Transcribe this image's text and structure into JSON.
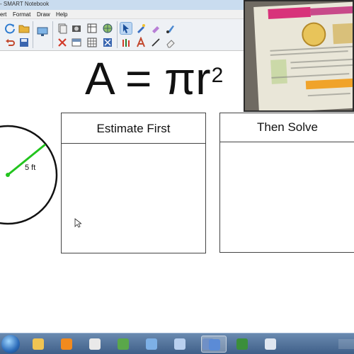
{
  "window": {
    "title": "- SMART Notebook"
  },
  "menu": {
    "items": [
      "ert",
      "Format",
      "Draw",
      "Help"
    ]
  },
  "toolbar": {
    "buttons": [
      "refresh-icon",
      "folder-icon",
      "display-icon",
      "copy-icon",
      "camera-icon",
      "table-icon",
      "globe-icon",
      "select-arrow-icon",
      "magic-pen-icon",
      "eraser-pen-icon",
      "paint-brush-icon",
      "undo-icon",
      "save-icon",
      "delete-icon",
      "screen-shade-icon",
      "table-grid-icon",
      "fullscreen-icon",
      "pens-icon",
      "text-icon",
      "line-icon",
      "eraser-icon"
    ],
    "selected": "select-arrow-icon"
  },
  "canvas": {
    "formula": {
      "left": "A = π",
      "right": "r",
      "exponent": "2"
    },
    "circle": {
      "radius_label": "5 ft",
      "stroke": "#111111",
      "radius_color": "#22c41e"
    },
    "boxes": [
      {
        "title": "Estimate First"
      },
      {
        "title": "Then Solve"
      }
    ]
  },
  "webcam": {
    "description_hidden": true
  },
  "taskbar": {
    "apps": [
      "windows-explorer-icon",
      "media-player-icon",
      "file-icon",
      "smart-notebook-icon",
      "presentation-icon",
      "document-icon",
      "smart-tools-icon",
      "board-icon",
      "paint-icon",
      "webcam-icon"
    ],
    "active_app": "board-icon"
  },
  "colors": {
    "accent": "#22c41e",
    "titlebar": "#c9dcef",
    "taskbar": "#3f5f88"
  }
}
